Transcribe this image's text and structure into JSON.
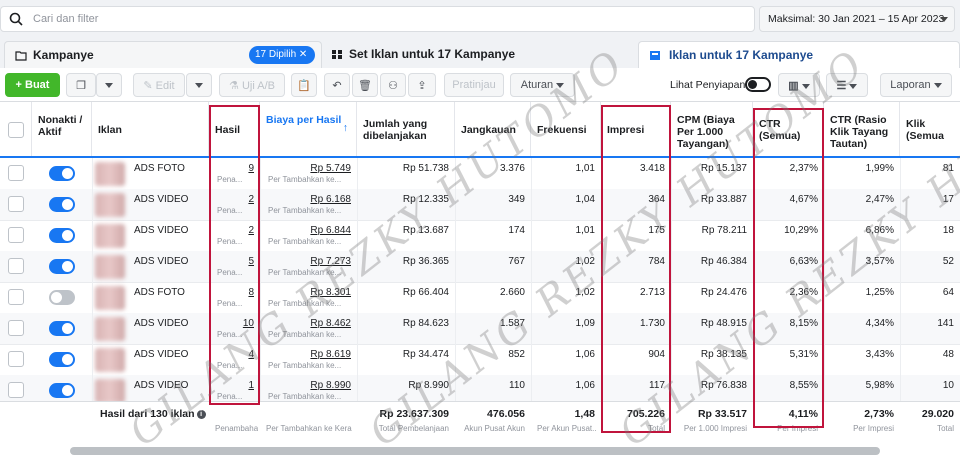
{
  "search": {
    "placeholder": "Cari dan filter"
  },
  "date_range": "Maksimal: 30 Jan 2021 – 15 Apr 2023",
  "tabs": {
    "campaign": "Kampanye",
    "selected_pill": "17 Dipilih",
    "adset": "Set Iklan untuk 17 Kampanye",
    "ads": "Iklan untuk 17 Kampanye"
  },
  "toolbar": {
    "create": "+ Buat",
    "edit": "Edit",
    "abtest": "Uji A/B",
    "preview": "Pratinjau",
    "rules": "Aturan",
    "show_preview": "Lihat Penyiapan",
    "reports": "Laporan"
  },
  "columns": {
    "onoff": "Nonakti / Aktif",
    "ad": "Iklan",
    "results": "Hasil",
    "cpr": "Biaya per Hasil",
    "spent": "Jumlah yang dibelanjakan",
    "reach": "Jangkauan",
    "freq": "Frekuensi",
    "impr": "Impresi",
    "cpm": "CPM (Biaya Per 1.000 Tayangan)",
    "ctr": "CTR (Semua)",
    "ctr_link": "CTR (Rasio Klik Tayang Tautan)",
    "clicks": "Klik (Semua"
  },
  "row_sub": {
    "results": "Pena...",
    "cpr": "Per Tambahkan ke..."
  },
  "rows": [
    {
      "name": "ADS FOTO",
      "results": "9",
      "cpr": "Rp 5.749",
      "spent": "Rp 51.738",
      "reach": "3.376",
      "freq": "1,01",
      "impr": "3.418",
      "cpm": "Rp 15.137",
      "ctr": "2,37%",
      "ctr_link": "1,99%",
      "clicks": "81",
      "active": true
    },
    {
      "name": "ADS VIDEO",
      "results": "2",
      "cpr": "Rp 6.168",
      "spent": "Rp 12.335",
      "reach": "349",
      "freq": "1,04",
      "impr": "364",
      "cpm": "Rp 33.887",
      "ctr": "4,67%",
      "ctr_link": "2,47%",
      "clicks": "17",
      "active": true
    },
    {
      "name": "ADS VIDEO",
      "results": "2",
      "cpr": "Rp 6.844",
      "spent": "Rp 13.687",
      "reach": "174",
      "freq": "1,01",
      "impr": "175",
      "cpm": "Rp 78.211",
      "ctr": "10,29%",
      "ctr_link": "6,86%",
      "clicks": "18",
      "active": true
    },
    {
      "name": "ADS VIDEO",
      "results": "5",
      "cpr": "Rp 7.273",
      "spent": "Rp 36.365",
      "reach": "767",
      "freq": "1,02",
      "impr": "784",
      "cpm": "Rp 46.384",
      "ctr": "6,63%",
      "ctr_link": "3,57%",
      "clicks": "52",
      "active": true
    },
    {
      "name": "ADS FOTO",
      "results": "8",
      "cpr": "Rp 8.301",
      "spent": "Rp 66.404",
      "reach": "2.660",
      "freq": "1,02",
      "impr": "2.713",
      "cpm": "Rp 24.476",
      "ctr": "2,36%",
      "ctr_link": "1,25%",
      "clicks": "64",
      "active": false
    },
    {
      "name": "ADS VIDEO",
      "results": "10",
      "cpr": "Rp 8.462",
      "spent": "Rp 84.623",
      "reach": "1.587",
      "freq": "1,09",
      "impr": "1.730",
      "cpm": "Rp 48.915",
      "ctr": "8,15%",
      "ctr_link": "4,34%",
      "clicks": "141",
      "active": true
    },
    {
      "name": "ADS VIDEO",
      "results": "4",
      "cpr": "Rp 8.619",
      "spent": "Rp 34.474",
      "reach": "852",
      "freq": "1,06",
      "impr": "904",
      "cpm": "Rp 38.135",
      "ctr": "5,31%",
      "ctr_link": "3,43%",
      "clicks": "48",
      "active": true
    },
    {
      "name": "ADS VIDEO",
      "results": "1",
      "cpr": "Rp 8.990",
      "spent": "Rp 8.990",
      "reach": "110",
      "freq": "1,06",
      "impr": "117",
      "cpm": "Rp 76.838",
      "ctr": "8,55%",
      "ctr_link": "5,98%",
      "clicks": "10",
      "active": true
    }
  ],
  "footer": {
    "label": "Hasil dari 130 iklan",
    "results_sub": "Penambaha",
    "cpr_sub": "Per Tambahkan ke Kera",
    "spent": "Rp 23.637.309",
    "spent_sub": "Total Pembelanjaan",
    "reach": "476.056",
    "reach_sub": "Akun Pusat Akun",
    "freq": "1,48",
    "freq_sub": "Per Akun Pusat...",
    "impr": "705.226",
    "impr_sub": "Total",
    "cpm": "Rp 33.517",
    "cpm_sub": "Per 1.000 Impresi",
    "ctr": "4,11%",
    "ctr_sub": "Per Impresi",
    "ctr_link": "2,73%",
    "ctr_link_sub": "Per Impresi",
    "clicks": "29.020",
    "clicks_sub": "Total"
  },
  "watermark": "GILANG REZKY HUTOMO",
  "colors": {
    "accent": "#1877f2",
    "create_green": "#42b72a",
    "highlight_red": "#c0143c"
  }
}
